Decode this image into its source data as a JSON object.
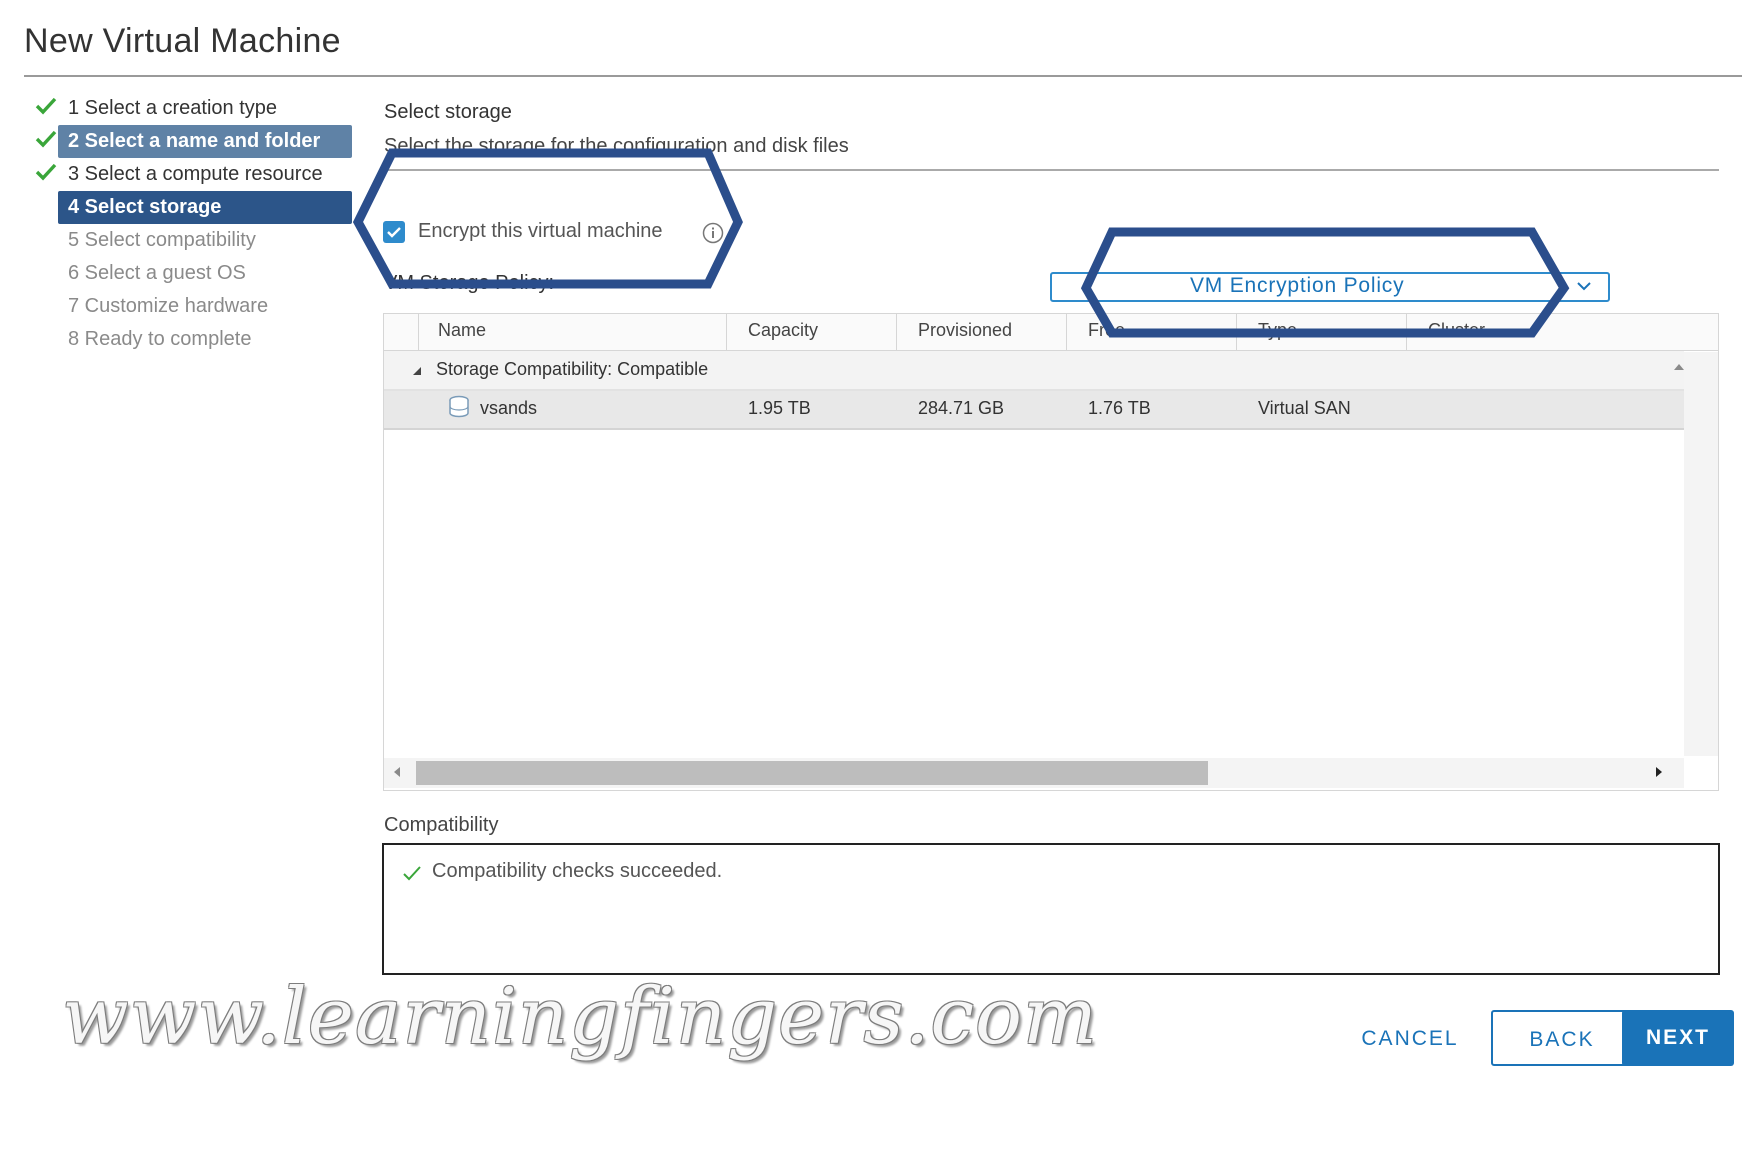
{
  "wizard": {
    "title": "New Virtual Machine"
  },
  "steps": [
    {
      "label": "1 Select a creation type",
      "state": "done"
    },
    {
      "label": "2 Select a name and folder",
      "state": "done"
    },
    {
      "label": "3 Select a compute resource",
      "state": "done"
    },
    {
      "label": "4 Select storage",
      "state": "current"
    },
    {
      "label": "5 Select compatibility",
      "state": "pending"
    },
    {
      "label": "6 Select a guest OS",
      "state": "pending"
    },
    {
      "label": "7 Customize hardware",
      "state": "pending"
    },
    {
      "label": "8 Ready to complete",
      "state": "pending"
    }
  ],
  "storage": {
    "title": "Select storage",
    "subtitle": "Select the storage for the configuration and disk files",
    "encrypt_label": "Encrypt this virtual machine",
    "encrypt_checked": true,
    "policy_label": "VM Storage Policy:",
    "policy_value": "VM Encryption Policy"
  },
  "table": {
    "columns": [
      "Name",
      "Capacity",
      "Provisioned",
      "Free",
      "Type",
      "Cluster"
    ],
    "group_label": "Storage Compatibility: Compatible",
    "rows": [
      {
        "name": "vsands",
        "capacity": "1.95 TB",
        "provisioned": "284.71 GB",
        "free": "1.76 TB",
        "type": "Virtual SAN"
      }
    ]
  },
  "compatibility": {
    "title": "Compatibility",
    "message": "Compatibility checks succeeded."
  },
  "buttons": {
    "cancel": "CANCEL",
    "back": "BACK",
    "next": "NEXT"
  },
  "watermark": "www.learningfingers.com",
  "colors": {
    "accent": "#1a73b8",
    "step_selected": "#2c5589",
    "check_green": "#3aa63a",
    "highlight": "#2b4e8c"
  },
  "icons": [
    "check-icon",
    "info-icon",
    "chevron-down-icon",
    "datastore-icon",
    "caret-down-icon",
    "scroll-arrow-icon"
  ]
}
